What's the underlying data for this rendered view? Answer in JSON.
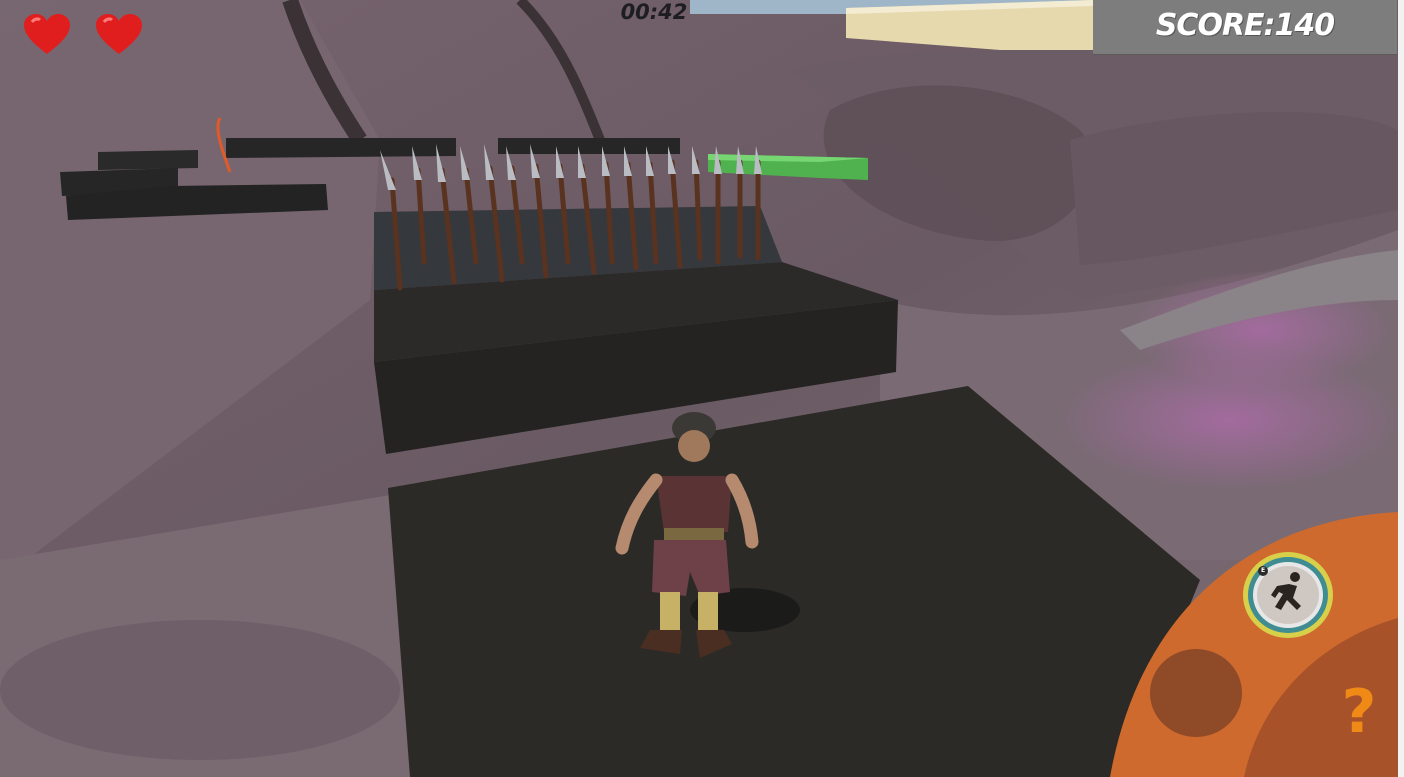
{
  "hud": {
    "lives": 2,
    "timer": "00:42",
    "score": "SCORE:140"
  },
  "controls": {
    "sprint_key": "E",
    "help": "?"
  },
  "colors": {
    "heart": "#e01e1e",
    "score_panel": "#7d7d7d",
    "joystick_base": "#cf6a2e",
    "joystick_knob": "#8f4a27",
    "help_icon": "#f08a16",
    "sprint_ring": "#d8d04a"
  }
}
